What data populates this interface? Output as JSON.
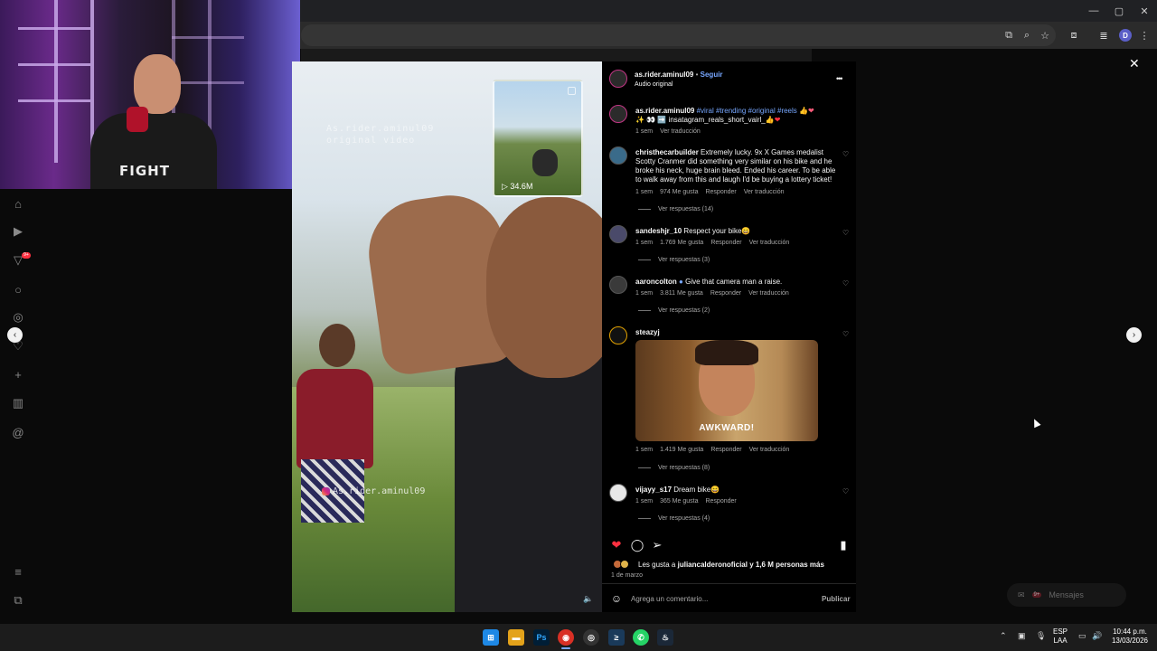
{
  "post": {
    "author": "as.rider.aminul09",
    "follow_label": "Seguir",
    "audio": "Audio original",
    "caption_hashtags": "#viral #trending #original #reels",
    "caption_line2": "✨ 👀 ➡️ insatagram_reals_short_vairl_",
    "caption_meta": "1 sem",
    "caption_translate": "Ver traducción",
    "more_label": "•••"
  },
  "comments": [
    {
      "user": "christhecarbuilder",
      "text": "Extremely lucky. 9x X Games medalist Scotty Cranmer did something very similar on his bike and he broke his neck, huge brain bleed. Ended his career. To be able to walk away from this and laugh I'd be buying a lottery ticket!",
      "time": "1 sem",
      "likes": "974 Me gusta",
      "reply": "Responder",
      "translate": "Ver traducción",
      "view_replies": "Ver respuestas (14)"
    },
    {
      "user": "sandeshjr_10",
      "text": "Respect your bike😄",
      "time": "1 sem",
      "likes": "1.769 Me gusta",
      "reply": "Responder",
      "translate": "Ver traducción",
      "view_replies": "Ver respuestas (3)"
    },
    {
      "user": "aaroncolton",
      "text": "Give that camera man a raise.",
      "time": "1 sem",
      "likes": "3.811 Me gusta",
      "reply": "Responder",
      "translate": "Ver traducción",
      "view_replies": "Ver respuestas (2)"
    },
    {
      "user": "steazyj",
      "gif_caption": "AWKWARD!",
      "time": "1 sem",
      "likes": "1.419 Me gusta",
      "reply": "Responder",
      "translate": "Ver traducción",
      "view_replies": "Ver respuestas (8)"
    },
    {
      "user": "vijayy_s17",
      "text": "Dream bike😄",
      "time": "1 sem",
      "likes": "365 Me gusta",
      "reply": "Responder",
      "view_replies": "Ver respuestas (4)"
    }
  ],
  "likes_summary": {
    "prefix": "Les gusta a",
    "user": "juliancalderonoficial",
    "suffix": "y 1,6 M personas más",
    "date": "1 de marzo"
  },
  "comment_box": {
    "placeholder": "Agrega un comentario...",
    "publish": "Publicar"
  },
  "video": {
    "watermark_top": "As.rider.aminul09\noriginal video",
    "watermark_bottom": "As.rider.aminul09",
    "pip_views": "▷ 34.6M"
  },
  "webcam": {
    "shirt_text": "FIGHT"
  },
  "sidebar": {
    "notification_badge": "9+"
  },
  "messages": {
    "label": "Mensajes",
    "badge": "9+"
  },
  "taskbar": {
    "lang_line1": "ESP",
    "lang_line2": "LAA",
    "time": "10:44 p.m.",
    "date": "13/03/2026"
  },
  "colors": {
    "like_red": "#ff3040",
    "link_blue": "#77a7ff",
    "panel_bg": "#000000"
  },
  "icons": [
    "home-icon",
    "reels-icon",
    "explore-icon",
    "search-icon",
    "compass-icon",
    "heart-icon",
    "create-icon",
    "dashboard-icon",
    "threads-icon",
    "menu-icon",
    "meta-icon",
    "share-icon",
    "comment-icon",
    "bookmark-icon",
    "emoji-icon",
    "close-icon"
  ]
}
